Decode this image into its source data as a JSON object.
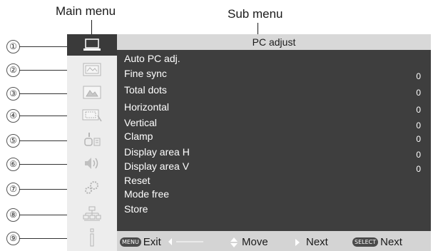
{
  "callouts": {
    "main_menu": "Main menu",
    "sub_menu": "Sub menu"
  },
  "numbers": [
    "①",
    "②",
    "③",
    "④",
    "⑤",
    "⑥",
    "⑦",
    "⑧",
    "⑨"
  ],
  "icons": [
    {
      "name": "pc-adjust-icon",
      "selected": true
    },
    {
      "name": "image-select-icon",
      "selected": false
    },
    {
      "name": "image-adjust-icon",
      "selected": false
    },
    {
      "name": "screen-icon",
      "selected": false
    },
    {
      "name": "setting-icon",
      "selected": false
    },
    {
      "name": "sound-icon",
      "selected": false
    },
    {
      "name": "expand-icon",
      "selected": false
    },
    {
      "name": "network-icon",
      "selected": false
    },
    {
      "name": "information-icon",
      "selected": false
    }
  ],
  "submenu": {
    "title": "PC adjust",
    "items": [
      {
        "label": "Auto PC adj.",
        "value": ""
      },
      {
        "label": "Fine sync",
        "value": "0"
      },
      {
        "label": "Total dots",
        "value": "0"
      },
      {
        "label": "Horizontal",
        "value": "0"
      },
      {
        "label": "Vertical",
        "value": "0"
      },
      {
        "label": "Clamp",
        "value": "0"
      },
      {
        "label": "Display area H",
        "value": "0"
      },
      {
        "label": "Display area V",
        "value": "0"
      },
      {
        "label": "Reset",
        "value": ""
      },
      {
        "label": "Mode free",
        "value": ""
      },
      {
        "label": "Store",
        "value": ""
      }
    ]
  },
  "footer": {
    "exit_key": "MENU",
    "exit_label": "Exit",
    "move_label": "Move",
    "next_label": "Next",
    "select_key": "SELECT",
    "select_next_label": "Next"
  }
}
